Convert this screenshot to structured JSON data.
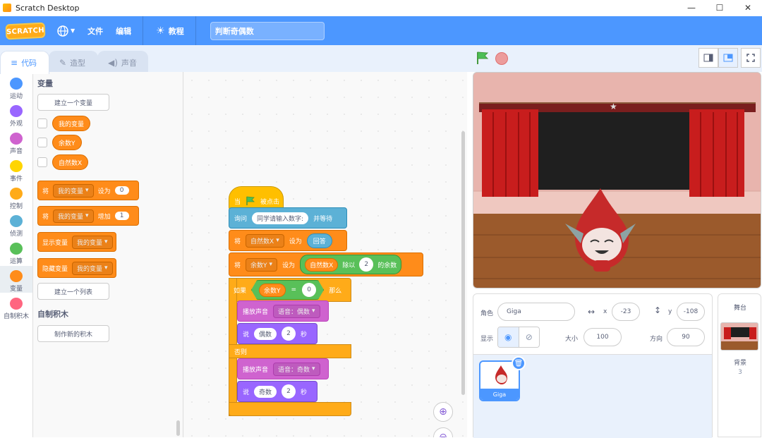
{
  "window": {
    "title": "Scratch Desktop",
    "controls": [
      "—",
      "☐",
      "✕"
    ]
  },
  "menubar": {
    "logo": "SCRATCH",
    "file": "文件",
    "edit": "编辑",
    "tutorials": "教程",
    "project_title": "判断奇偶数"
  },
  "tabs": [
    {
      "label": "代码",
      "icon": "code-icon",
      "active": true
    },
    {
      "label": "造型",
      "icon": "brush-icon",
      "active": false
    },
    {
      "label": "声音",
      "icon": "speaker-icon",
      "active": false
    }
  ],
  "categories": [
    {
      "label": "运动",
      "color": "#4c97ff"
    },
    {
      "label": "外观",
      "color": "#9966ff"
    },
    {
      "label": "声音",
      "color": "#cf63cf"
    },
    {
      "label": "事件",
      "color": "#ffd500"
    },
    {
      "label": "控制",
      "color": "#ffab19"
    },
    {
      "label": "侦测",
      "color": "#5cb1d6"
    },
    {
      "label": "运算",
      "color": "#59c059"
    },
    {
      "label": "变量",
      "color": "#ff8c1a"
    },
    {
      "label": "自制积木",
      "color": "#ff6680"
    }
  ],
  "palette": {
    "variables_title": "变量",
    "make_variable": "建立一个变量",
    "variables": [
      "我的变量",
      "余数Y",
      "自然数X"
    ],
    "set_block": {
      "label": "将",
      "var": "我的变量",
      "to": "设为",
      "value": "0"
    },
    "change_block": {
      "label": "将",
      "var": "我的变量",
      "by": "增加",
      "value": "1"
    },
    "show_block": {
      "label": "显示变量",
      "var": "我的变量"
    },
    "hide_block": {
      "label": "隐藏变量",
      "var": "我的变量"
    },
    "make_list": "建立一个列表",
    "myblocks_title": "自制积木",
    "make_block": "制作新的积木"
  },
  "script": {
    "hat": {
      "prefix": "当",
      "suffix": "被点击"
    },
    "ask": {
      "label": "询问",
      "text": "同学请输入数字:",
      "wait": "并等待"
    },
    "set_x": {
      "label": "将",
      "var": "自然数X",
      "to": "设为",
      "value": "回答"
    },
    "set_y": {
      "label": "将",
      "var": "余数Y",
      "to": "设为",
      "left": "自然数X",
      "op": "除以",
      "right": "2",
      "suffix": "的余数"
    },
    "if": {
      "label": "如果",
      "left": "余数Y",
      "op": "=",
      "right": "0",
      "then": "那么",
      "else": "否则"
    },
    "play_even": {
      "label": "播放声音",
      "sound": "语音：偶数"
    },
    "say_even": {
      "label": "说",
      "text": "偶数",
      "secs": "2",
      "unit": "秒"
    },
    "play_odd": {
      "label": "播放声音",
      "sound": "语音：奇数"
    },
    "say_odd": {
      "label": "说",
      "text": "奇数",
      "secs": "2",
      "unit": "秒"
    }
  },
  "sprite_info": {
    "sprite_label": "角色",
    "sprite_name": "Giga",
    "x_label": "x",
    "x": "-23",
    "y_label": "y",
    "y": "-108",
    "show_label": "显示",
    "size_label": "大小",
    "size": "100",
    "direction_label": "方向",
    "direction": "90"
  },
  "sprites": [
    {
      "name": "Giga",
      "selected": true
    }
  ],
  "stage_pane": {
    "title": "舞台",
    "backdrop_label": "背景",
    "backdrop_count": "3"
  },
  "colors": {
    "menu_blue": "#4c97ff",
    "variables_orange": "#ff8c1a",
    "control_yellow": "#ffab19",
    "events_yellow": "#ffbf00"
  }
}
